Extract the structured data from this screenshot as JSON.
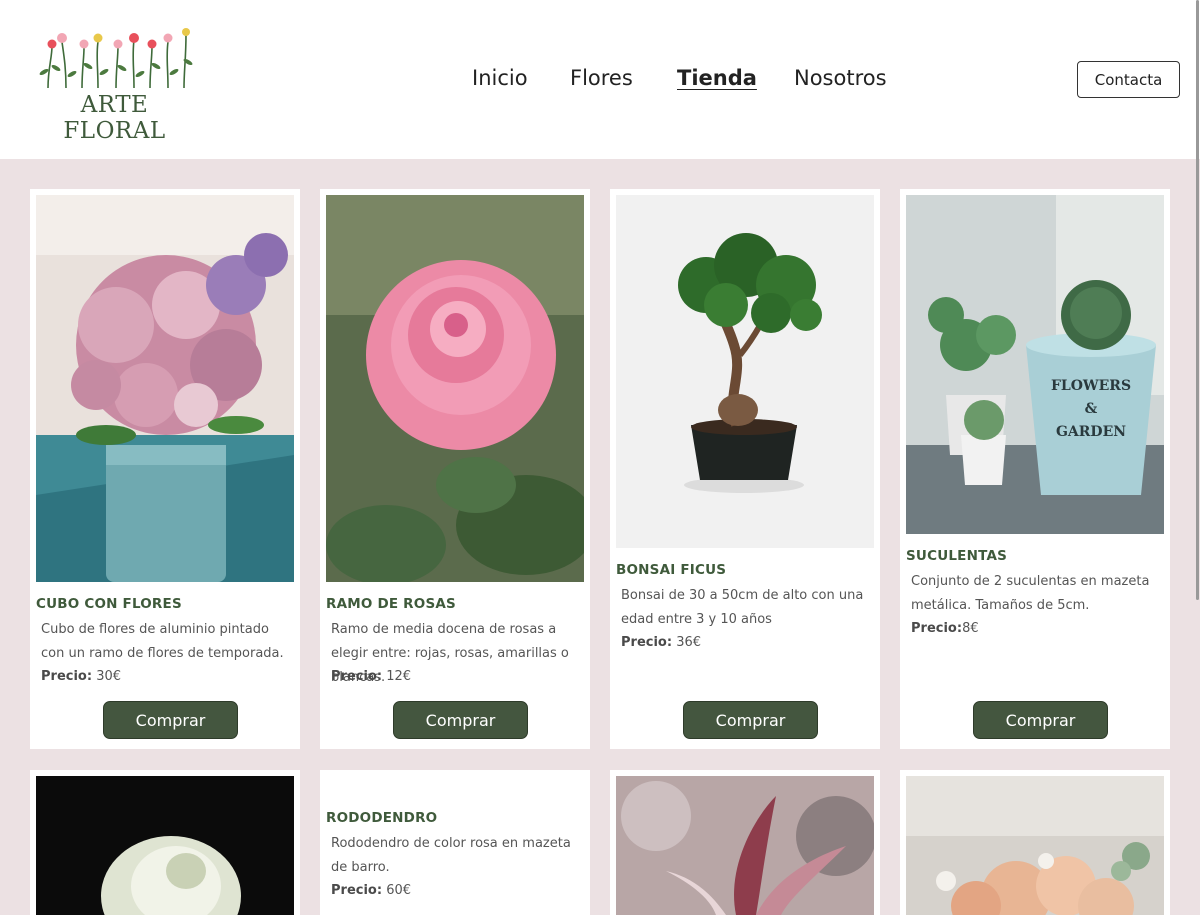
{
  "brand": {
    "name": "ARTE FLORAL",
    "text_color": "#3f5a3b"
  },
  "nav": {
    "items": [
      {
        "label": "Inicio"
      },
      {
        "label": "Flores"
      },
      {
        "label": "Tienda",
        "active": true
      },
      {
        "label": "Nosotros"
      }
    ]
  },
  "header": {
    "contact_label": "Contacta"
  },
  "colors": {
    "accent": "#44563f",
    "background": "#ece1e3",
    "title": "#3f5a3b"
  },
  "price_label": "Precio:",
  "products": [
    {
      "title": "CUBO CON FLORES",
      "description": "Cubo de flores de aluminio pintado con un ramo de flores de temporada.",
      "price": "30€",
      "button": "Comprar",
      "image_icon": "flower-bucket-photo"
    },
    {
      "title": "RAMO DE ROSAS",
      "description": "Ramo de media docena de rosas a elegir entre: rojas, rosas, amarillas o blancas.",
      "price": "12€",
      "button": "Comprar",
      "image_icon": "pink-rose-photo"
    },
    {
      "title": "BONSAI FICUS",
      "description": "Bonsai de 30 a 50cm de alto con una edad entre 3 y 10 años",
      "price": "36€",
      "button": "Comprar",
      "image_icon": "bonsai-photo"
    },
    {
      "title": "SUCULENTAS",
      "description": "Conjunto de 2 suculentas en mazeta metálica. Tamaños de 5cm.",
      "price": "8€",
      "button": "Comprar",
      "image_icon": "succulents-photo"
    },
    {
      "title": "",
      "description": "",
      "price": "",
      "button": "",
      "image_icon": "white-rose-photo"
    },
    {
      "title": "RODODENDRO",
      "description": "Rododendro de color rosa en mazeta de barro.",
      "price": "60€",
      "button": "",
      "image_icon": ""
    },
    {
      "title": "",
      "description": "",
      "price": "",
      "button": "",
      "image_icon": "magnolia-photo"
    },
    {
      "title": "",
      "description": "",
      "price": "",
      "button": "",
      "image_icon": "dahlia-bouquet-photo"
    }
  ]
}
